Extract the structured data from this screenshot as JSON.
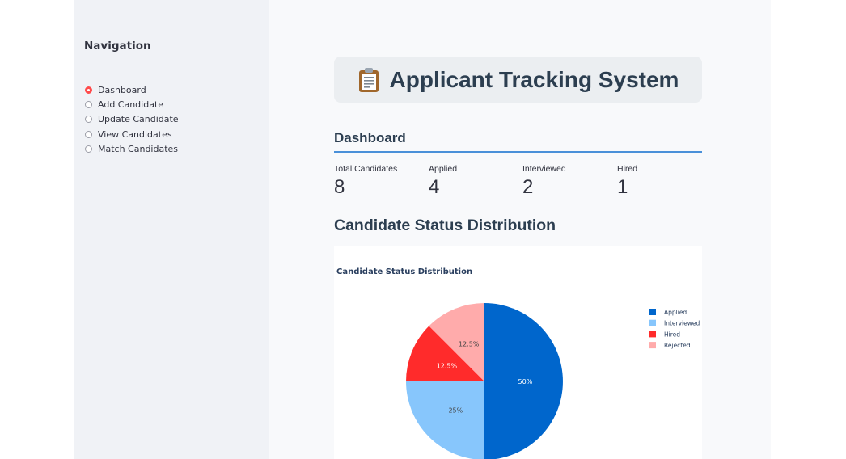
{
  "sidebar": {
    "title": "Navigation",
    "items": [
      {
        "label": "Dashboard",
        "selected": true
      },
      {
        "label": "Add Candidate",
        "selected": false
      },
      {
        "label": "Update Candidate",
        "selected": false
      },
      {
        "label": "View Candidates",
        "selected": false
      },
      {
        "label": "Match Candidates",
        "selected": false
      }
    ]
  },
  "header": {
    "icon": "clipboard-icon",
    "title": "Applicant Tracking System"
  },
  "dashboard": {
    "section_title": "Dashboard",
    "metrics": [
      {
        "label": "Total Candidates",
        "value": "8"
      },
      {
        "label": "Applied",
        "value": "4"
      },
      {
        "label": "Interviewed",
        "value": "2"
      },
      {
        "label": "Hired",
        "value": "1"
      }
    ],
    "chart_heading": "Candidate Status Distribution"
  },
  "colors": {
    "accent": "#ff4b4b",
    "rule": "#4a90d9",
    "heading": "#2c3e50"
  },
  "chart_data": {
    "type": "pie",
    "title": "Candidate Status Distribution",
    "labels": [
      "Applied",
      "Interviewed",
      "Hired",
      "Rejected"
    ],
    "values": [
      4,
      2,
      1,
      1
    ],
    "percent_labels": [
      "50%",
      "25%",
      "12.5%",
      "12.5%"
    ],
    "colors": [
      "#0066cc",
      "#87c6fc",
      "#ff2b2b",
      "#ffabab"
    ],
    "legend_position": "right"
  }
}
